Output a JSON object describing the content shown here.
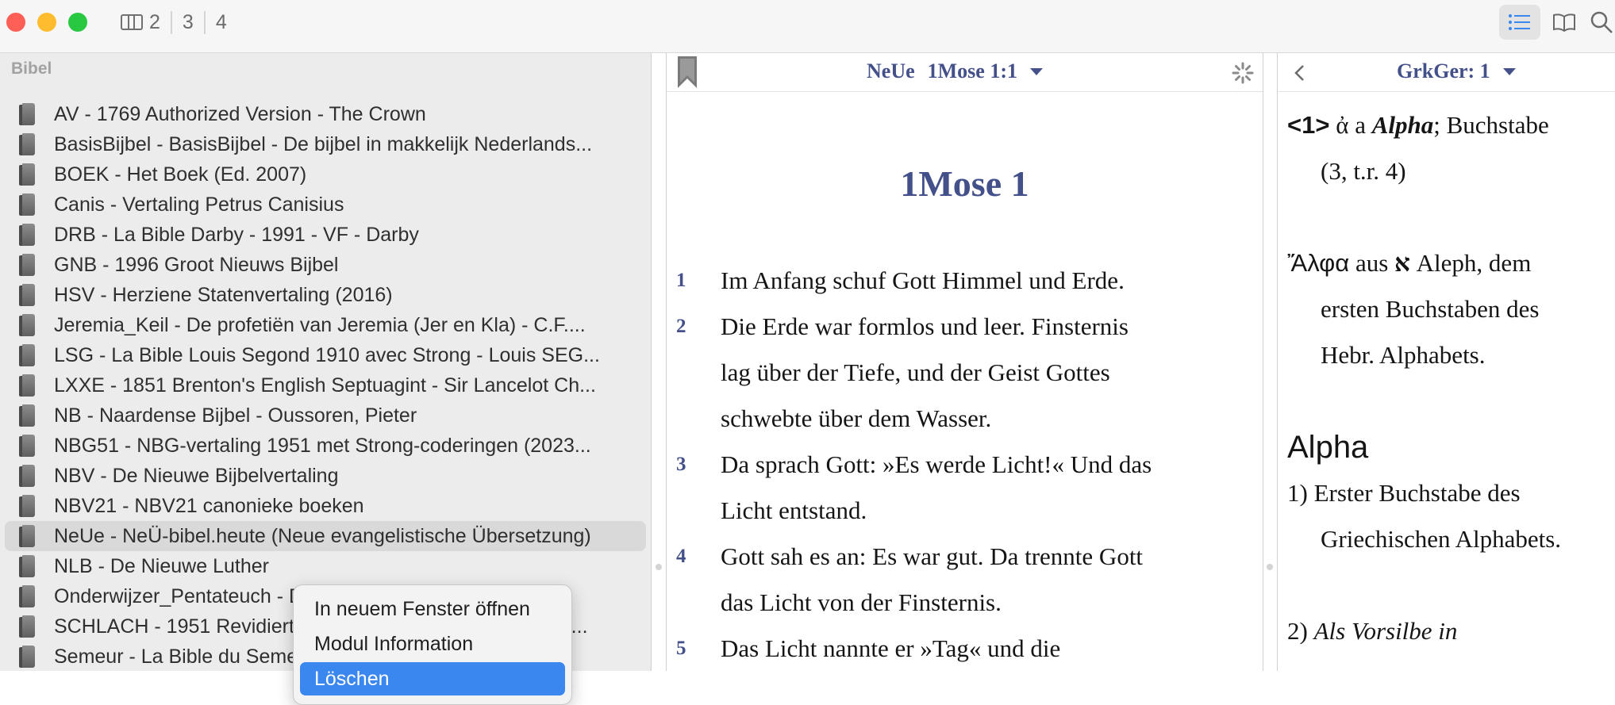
{
  "toolbar": {
    "window_numbers": [
      "2",
      "3",
      "4"
    ]
  },
  "sidebar": {
    "title": "Bibel",
    "modules": [
      {
        "label": "AV - 1769 Authorized Version - The Crown"
      },
      {
        "label": "BasisBijbel - BasisBijbel - De bijbel in makkelijk Nederlands..."
      },
      {
        "label": "BOEK - Het Boek (Ed. 2007)"
      },
      {
        "label": "Canis - Vertaling Petrus Canisius"
      },
      {
        "label": "DRB - La Bible Darby - 1991 - VF - Darby"
      },
      {
        "label": "GNB - 1996 Groot Nieuws Bijbel"
      },
      {
        "label": "HSV - Herziene Statenvertaling (2016)"
      },
      {
        "label": "Jeremia_Keil - De profetiën van Jeremia (Jer en Kla) - C.F...."
      },
      {
        "label": "LSG - La Bible Louis Segond 1910 avec Strong - Louis SEG..."
      },
      {
        "label": "LXXE - 1851 Brenton's English Septuagint - Sir Lancelot Ch..."
      },
      {
        "label": "NB - Naardense Bijbel - Oussoren, Pieter"
      },
      {
        "label": "NBG51 - NBG-vertaling 1951 met Strong-coderingen (2023..."
      },
      {
        "label": "NBV - De Nieuwe Bijbelvertaling"
      },
      {
        "label": "NBV21 - NBV21 canonieke boeken"
      },
      {
        "label": "NeUe - NeÜ-bibel.heute (Neue evangelistische Übersetzung)"
      },
      {
        "label": "NLB - De Nieuwe Luther"
      },
      {
        "label": "Onderwijzer_Pentateuch - De Pentateuch - Onderwijz..."
      },
      {
        "label": "SCHLACH - 1951 Revidierte Schlachter-Bibel - Schlachter,..."
      },
      {
        "label": "Semeur - La Bible du Semeur 2015"
      }
    ],
    "selected_index": 14
  },
  "context_menu": {
    "items": [
      {
        "label": "In neuem Fenster öffnen"
      },
      {
        "label": "Modul Information"
      },
      {
        "label": "Löschen"
      }
    ],
    "highlighted_index": 2
  },
  "middle_pane": {
    "module": "NeUe",
    "reference": "1Mose 1:1",
    "chapter_heading": "1Mose 1",
    "verses": [
      {
        "num": "1",
        "lines": [
          "Im Anfang schuf Gott Himmel und Erde."
        ]
      },
      {
        "num": "2",
        "lines": [
          "Die Erde war formlos und leer. Finsternis",
          "lag über der Tiefe, und der Geist Gottes",
          "schwebte über dem Wasser."
        ]
      },
      {
        "num": "3",
        "lines": [
          "Da sprach Gott: »Es werde Licht!« Und das",
          "Licht entstand."
        ]
      },
      {
        "num": "4",
        "lines": [
          "Gott sah es an: Es war gut. Da trennte Gott",
          "das Licht von der Finsternis."
        ]
      },
      {
        "num": "5",
        "lines": [
          "Das Licht nannte er »Tag« und die"
        ]
      }
    ]
  },
  "right_pane": {
    "title": "GrkGer: 1",
    "entry_num": "<1>",
    "entry_greek": "ἀ",
    "entry_a": "a",
    "entry_word": "Alpha",
    "entry_rest": "; Buchstabe",
    "entry_sub": "(3, t.r. 4)",
    "alpha_greek": "Ἄλφα",
    "alpha_aus": "aus",
    "alpha_hebrew": "א",
    "alpha_rest": "Aleph, dem",
    "alpha_line2": "ersten Buchstaben des",
    "alpha_line3": "Hebr. Alphabets.",
    "heading": "Alpha",
    "def1_line1": "1) Erster Buchstabe des",
    "def1_line2": "Griechischen Alphabets.",
    "def2_num": "2)",
    "def2_text": "Als Vorsilbe in"
  },
  "colors": {
    "accent_blue": "#3b87f0",
    "header_text": "#44508a"
  }
}
